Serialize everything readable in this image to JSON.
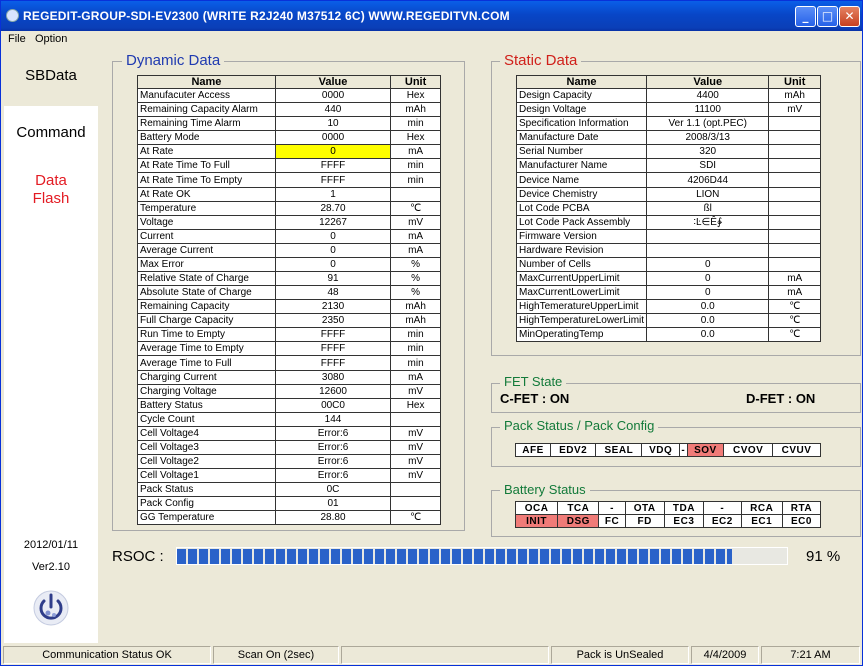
{
  "title": "REGEDIT-GROUP-SDI-EV2300   (WRITE R2J240 M37512 6C)    WWW.REGEDITVN.COM",
  "window_buttons": {
    "minimize": "_",
    "maximize": "□",
    "close": "✕"
  },
  "menu": [
    "File",
    "Option"
  ],
  "nav": {
    "sbdata": "SBData",
    "command": "Command",
    "dataflash": "Data\nFlash"
  },
  "left_info": {
    "date": "2012/01/11",
    "version": "Ver2.10"
  },
  "dynamic": {
    "title": "Dynamic Data",
    "headers": [
      "Name",
      "Value",
      "Unit"
    ],
    "rows": [
      [
        "Manufacuter Access",
        "0000",
        "Hex"
      ],
      [
        "Remaining Capacity Alarm",
        "440",
        "mAh"
      ],
      [
        "Remaining Time Alarm",
        "10",
        "min"
      ],
      [
        "Battery Mode",
        "0000",
        "Hex"
      ],
      [
        "At Rate",
        "0",
        "mA"
      ],
      [
        "At Rate Time To Full",
        "FFFF",
        "min"
      ],
      [
        "At Rate Time To Empty",
        "FFFF",
        "min"
      ],
      [
        "At Rate OK",
        "1",
        ""
      ],
      [
        "Temperature",
        "28.70",
        "℃"
      ],
      [
        "Voltage",
        "12267",
        "mV"
      ],
      [
        "Current",
        "0",
        "mA"
      ],
      [
        "Average Current",
        "0",
        "mA"
      ],
      [
        "Max Error",
        "0",
        "%"
      ],
      [
        "Relative State of Charge",
        "91",
        "%"
      ],
      [
        "Absolute State of Charge",
        "48",
        "%"
      ],
      [
        "Remaining Capacity",
        "2130",
        "mAh"
      ],
      [
        "Full Charge Capacity",
        "2350",
        "mAh"
      ],
      [
        "Run Time to Empty",
        "FFFF",
        "min"
      ],
      [
        "Average Time to Empty",
        "FFFF",
        "min"
      ],
      [
        "Average Time to Full",
        "FFFF",
        "min"
      ],
      [
        "Charging Current",
        "3080",
        "mA"
      ],
      [
        "Charging Voltage",
        "12600",
        "mV"
      ],
      [
        "Battery Status",
        "00C0",
        "Hex"
      ],
      [
        "Cycle Count",
        "144",
        ""
      ],
      [
        "Cell Voltage4",
        "Error:6",
        "mV"
      ],
      [
        "Cell Voltage3",
        "Error:6",
        "mV"
      ],
      [
        "Cell Voltage2",
        "Error:6",
        "mV"
      ],
      [
        "Cell Voltage1",
        "Error:6",
        "mV"
      ],
      [
        "Pack Status",
        "0C",
        ""
      ],
      [
        "Pack Config",
        "01",
        ""
      ],
      [
        "GG Temperature",
        "28.80",
        "℃"
      ]
    ],
    "highlight_color": "#ffff00"
  },
  "static": {
    "title": "Static Data",
    "headers": [
      "Name",
      "Value",
      "Unit"
    ],
    "rows": [
      [
        "Design Capacity",
        "4400",
        "mAh"
      ],
      [
        "Design Voltage",
        "11100",
        "mV"
      ],
      [
        "Specification Information",
        "Ver 1.1 (opt.PEC)",
        ""
      ],
      [
        "Manufacture Date",
        "2008/3/13",
        ""
      ],
      [
        "Serial Number",
        "320",
        ""
      ],
      [
        "Manufacturer Name",
        "SDI",
        ""
      ],
      [
        "Device Name",
        "4206D44",
        ""
      ],
      [
        "Device Chemistry",
        "LION",
        ""
      ],
      [
        "Lot Code PCBA",
        "ßl",
        ""
      ],
      [
        "Lot Code Pack Assembly",
        "∶Ŀ∈Ê∳",
        ""
      ],
      [
        "Firmware Version",
        "",
        ""
      ],
      [
        "Hardware Revision",
        "",
        ""
      ],
      [
        "Number of Cells",
        "0",
        ""
      ],
      [
        "MaxCurrentUpperLimit",
        "0",
        "mA"
      ],
      [
        "MaxCurrentLowerLimit",
        "0",
        "mA"
      ],
      [
        "HighTemeratureUpperLimit",
        "0.0",
        "℃"
      ],
      [
        "HighTemperatureLowerLimit",
        "0.0",
        "℃"
      ],
      [
        "MinOperatingTemp",
        "0.0",
        "℃"
      ]
    ]
  },
  "fet": {
    "title": "FET State",
    "cfet": "C-FET : ON",
    "dfet": "D-FET : ON"
  },
  "pack": {
    "title": "Pack Status / Pack Config",
    "cells": [
      {
        "label": "AFE",
        "on": false
      },
      {
        "label": "EDV2",
        "on": false
      },
      {
        "label": "SEAL",
        "on": false
      },
      {
        "label": "VDQ",
        "on": false
      },
      {
        "label": "-",
        "on": false
      },
      {
        "label": "SOV",
        "on": true
      },
      {
        "label": "CVOV",
        "on": false
      },
      {
        "label": "CVUV",
        "on": false
      }
    ]
  },
  "battery_status": {
    "title": "Battery Status",
    "rows": [
      [
        {
          "label": "OCA",
          "on": false
        },
        {
          "label": "TCA",
          "on": false
        },
        {
          "label": "-",
          "on": false
        },
        {
          "label": "OTA",
          "on": false
        },
        {
          "label": "TDA",
          "on": false
        },
        {
          "label": "-",
          "on": false
        },
        {
          "label": "RCA",
          "on": false
        },
        {
          "label": "RTA",
          "on": false
        }
      ],
      [
        {
          "label": "INIT",
          "on": true
        },
        {
          "label": "DSG",
          "on": true
        },
        {
          "label": "FC",
          "on": false
        },
        {
          "label": "FD",
          "on": false
        },
        {
          "label": "EC3",
          "on": false
        },
        {
          "label": "EC2",
          "on": false
        },
        {
          "label": "EC1",
          "on": false
        },
        {
          "label": "EC0",
          "on": false
        }
      ]
    ],
    "on_color": "#f07b78"
  },
  "rsoc": {
    "label": "RSOC :",
    "value_text": "91 %",
    "fraction": 0.91
  },
  "statusbar": [
    "Communication Status OK",
    "Scan On (2sec)",
    "",
    "Pack is UnSealed",
    "4/4/2009",
    "7:21 AM"
  ]
}
